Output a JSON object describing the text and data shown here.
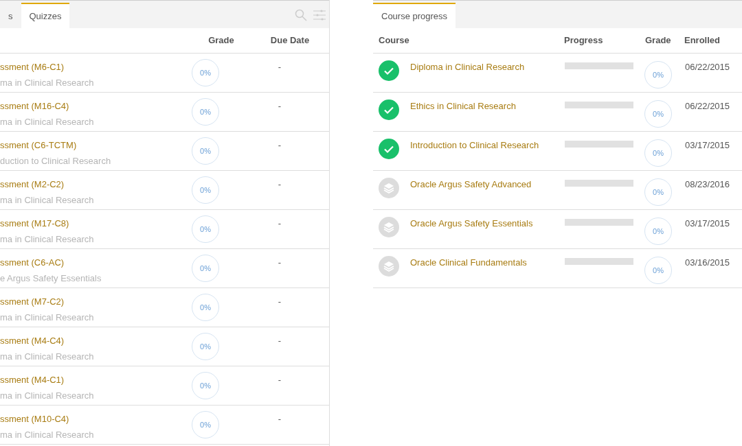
{
  "quizzes_panel": {
    "tabs": [
      {
        "label": "s",
        "selected": false
      },
      {
        "label": "Quizzes",
        "selected": true
      }
    ],
    "columns": [
      "Grade",
      "Due Date"
    ],
    "rows": [
      {
        "title": "ssment (M6-C1)",
        "course": "ma in Clinical Research",
        "grade": "0%",
        "due": "-"
      },
      {
        "title": "ssment (M16-C4)",
        "course": "ma in Clinical Research",
        "grade": "0%",
        "due": "-"
      },
      {
        "title": "ssment (C6-TCTM)",
        "course": "duction to Clinical Research",
        "grade": "0%",
        "due": "-"
      },
      {
        "title": "ssment (M2-C2)",
        "course": "ma in Clinical Research",
        "grade": "0%",
        "due": "-"
      },
      {
        "title": "ssment (M17-C8)",
        "course": "ma in Clinical Research",
        "grade": "0%",
        "due": "-"
      },
      {
        "title": "ssment (C6-AC)",
        "course": "e Argus Safety Essentials",
        "grade": "0%",
        "due": "-"
      },
      {
        "title": "ssment (M7-C2)",
        "course": "ma in Clinical Research",
        "grade": "0%",
        "due": "-"
      },
      {
        "title": "ssment (M4-C4)",
        "course": "ma in Clinical Research",
        "grade": "0%",
        "due": "-"
      },
      {
        "title": "ssment (M4-C1)",
        "course": "ma in Clinical Research",
        "grade": "0%",
        "due": "-"
      },
      {
        "title": "ssment (M10-C4)",
        "course": "ma in Clinical Research",
        "grade": "0%",
        "due": "-"
      }
    ]
  },
  "progress_panel": {
    "tabs": [
      {
        "label": "Course progress",
        "selected": true
      }
    ],
    "columns": [
      "Course",
      "Progress",
      "Grade",
      "Enrolled"
    ],
    "rows": [
      {
        "kind": "completed",
        "course": "Diploma in Clinical Research",
        "level": 0,
        "grade": "0%",
        "enrolled": "06/22/2015"
      },
      {
        "kind": "completed",
        "course": "Ethics in Clinical Research",
        "level": 0,
        "grade": "0%",
        "enrolled": "06/22/2015"
      },
      {
        "kind": "completed",
        "course": "Introduction to Clinical Research",
        "level": 0,
        "grade": "0%",
        "enrolled": "03/17/2015"
      },
      {
        "kind": "pending",
        "course": "Oracle Argus Safety Advanced",
        "level": 0,
        "grade": "0%",
        "enrolled": "08/23/2016"
      },
      {
        "kind": "pending",
        "course": "Oracle Argus Safety Essentials",
        "level": 0,
        "grade": "0%",
        "enrolled": "03/17/2015"
      },
      {
        "kind": "pending",
        "course": "Oracle Clinical Fundamentals",
        "level": 0,
        "grade": "0%",
        "enrolled": "03/16/2015"
      }
    ]
  }
}
